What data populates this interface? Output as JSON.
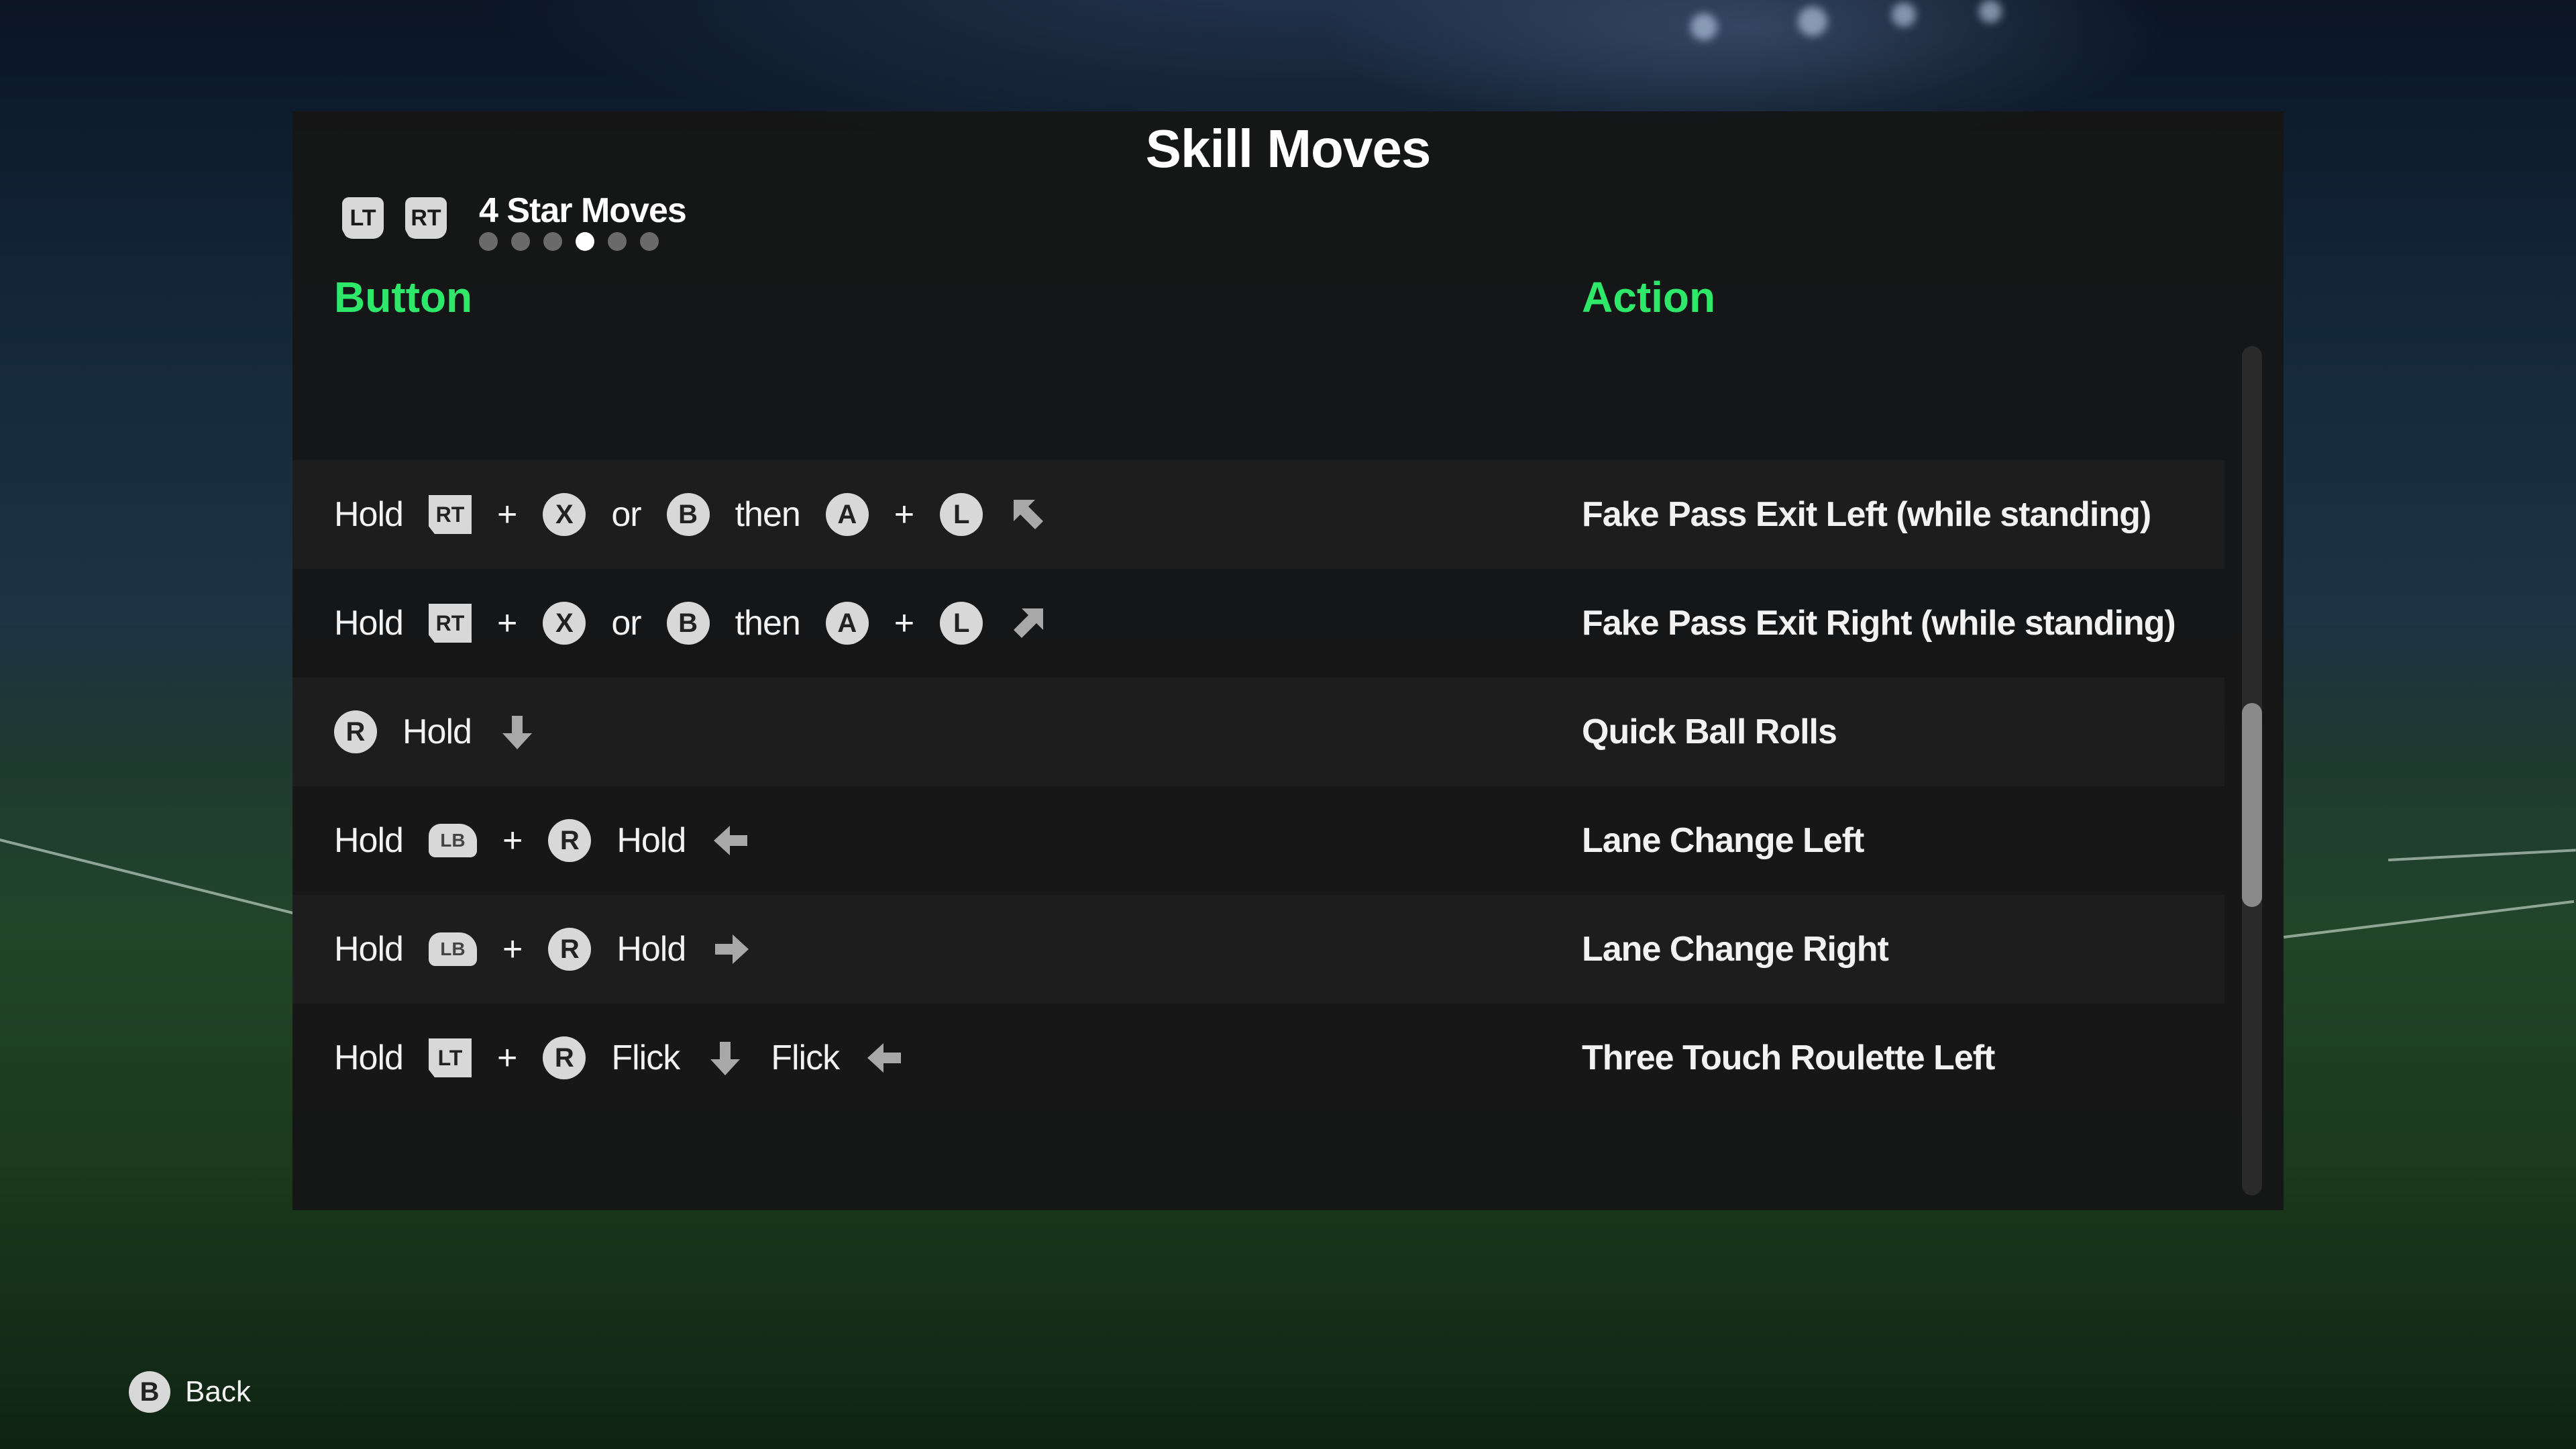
{
  "screen": {
    "title": "Skill Moves",
    "category_title": "4 Star Moves",
    "prev_trigger": "LT",
    "next_trigger": "RT",
    "page_dots": 6,
    "active_dot": 4
  },
  "columns": {
    "button": "Button",
    "action": "Action"
  },
  "rows": [
    {
      "combo": [
        {
          "k": "text",
          "v": "Hold"
        },
        {
          "k": "trig",
          "v": "RT"
        },
        {
          "k": "plus",
          "v": "+"
        },
        {
          "k": "circ",
          "v": "X"
        },
        {
          "k": "text",
          "v": "or"
        },
        {
          "k": "circ",
          "v": "B"
        },
        {
          "k": "text",
          "v": "then"
        },
        {
          "k": "circ",
          "v": "A"
        },
        {
          "k": "plus",
          "v": "+"
        },
        {
          "k": "circ",
          "v": "L"
        },
        {
          "k": "arrow",
          "v": "up-left"
        }
      ],
      "action": "Fake Pass Exit Left (while standing)"
    },
    {
      "combo": [
        {
          "k": "text",
          "v": "Hold"
        },
        {
          "k": "trig",
          "v": "RT"
        },
        {
          "k": "plus",
          "v": "+"
        },
        {
          "k": "circ",
          "v": "X"
        },
        {
          "k": "text",
          "v": "or"
        },
        {
          "k": "circ",
          "v": "B"
        },
        {
          "k": "text",
          "v": "then"
        },
        {
          "k": "circ",
          "v": "A"
        },
        {
          "k": "plus",
          "v": "+"
        },
        {
          "k": "circ",
          "v": "L"
        },
        {
          "k": "arrow",
          "v": "up-right"
        }
      ],
      "action": "Fake Pass Exit Right (while standing)"
    },
    {
      "combo": [
        {
          "k": "circ",
          "v": "R"
        },
        {
          "k": "text",
          "v": "Hold"
        },
        {
          "k": "arrow",
          "v": "down"
        }
      ],
      "action": "Quick Ball Rolls"
    },
    {
      "combo": [
        {
          "k": "text",
          "v": "Hold"
        },
        {
          "k": "bump",
          "v": "LB"
        },
        {
          "k": "plus",
          "v": "+"
        },
        {
          "k": "circ",
          "v": "R"
        },
        {
          "k": "text",
          "v": "Hold"
        },
        {
          "k": "arrow",
          "v": "left"
        }
      ],
      "action": "Lane Change Left"
    },
    {
      "combo": [
        {
          "k": "text",
          "v": "Hold"
        },
        {
          "k": "bump",
          "v": "LB"
        },
        {
          "k": "plus",
          "v": "+"
        },
        {
          "k": "circ",
          "v": "R"
        },
        {
          "k": "text",
          "v": "Hold"
        },
        {
          "k": "arrow",
          "v": "right"
        }
      ],
      "action": "Lane Change Right"
    },
    {
      "combo": [
        {
          "k": "text",
          "v": "Hold"
        },
        {
          "k": "trig",
          "v": "LT"
        },
        {
          "k": "plus",
          "v": "+"
        },
        {
          "k": "circ",
          "v": "R"
        },
        {
          "k": "text",
          "v": "Flick"
        },
        {
          "k": "arrow",
          "v": "down"
        },
        {
          "k": "text",
          "v": "Flick"
        },
        {
          "k": "arrow",
          "v": "left"
        }
      ],
      "action": "Three Touch Roulette Left"
    }
  ],
  "scroll": {
    "position_fraction": 0.42,
    "visible_fraction": 0.24
  },
  "footer": {
    "back_button": "B",
    "back_label": "Back"
  },
  "colors": {
    "header_accent": "#2ee86a",
    "panel": "#161616",
    "row_alt": "#1d1d1d"
  }
}
